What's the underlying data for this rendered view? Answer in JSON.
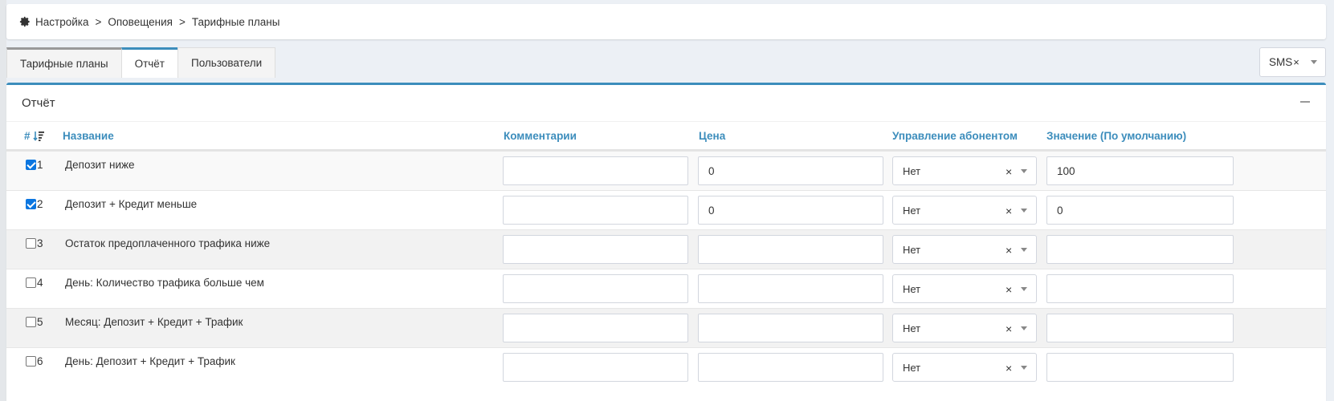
{
  "breadcrumb": {
    "icon": "gear-icon",
    "items": [
      "Настройка",
      "Оповещения",
      "Тарифные планы"
    ],
    "separator": ">"
  },
  "tabs": [
    {
      "label": "Тарифные планы",
      "active": false
    },
    {
      "label": "Отчёт",
      "active": true
    },
    {
      "label": "Пользователи",
      "active": false
    }
  ],
  "channel_select": {
    "value": "SMS",
    "clear": "×"
  },
  "box": {
    "title": "Отчёт"
  },
  "table": {
    "headers": {
      "num": "#",
      "name": "Название",
      "comment": "Комментарии",
      "price": "Цена",
      "control": "Управление абонентом",
      "value": "Значение (По умолчанию)"
    },
    "rows": [
      {
        "checked": true,
        "num": "1",
        "name": "Депозит ниже",
        "comment": "",
        "price": "0",
        "control": "Нет",
        "value": "100"
      },
      {
        "checked": true,
        "num": "2",
        "name": "Депозит + Кредит меньше",
        "comment": "",
        "price": "0",
        "control": "Нет",
        "value": "0"
      },
      {
        "checked": false,
        "num": "3",
        "name": "Остаток предоплаченного трафика ниже",
        "comment": "",
        "price": "",
        "control": "Нет",
        "value": ""
      },
      {
        "checked": false,
        "num": "4",
        "name": "День: Количество трафика больше чем",
        "comment": "",
        "price": "",
        "control": "Нет",
        "value": ""
      },
      {
        "checked": false,
        "num": "5",
        "name": "Месяц: Депозит + Кредит + Трафик",
        "comment": "",
        "price": "",
        "control": "Нет",
        "value": ""
      },
      {
        "checked": false,
        "num": "6",
        "name": "День: Депозит + Кредит + Трафик",
        "comment": "",
        "price": "",
        "control": "Нет",
        "value": ""
      }
    ],
    "clear_symbol": "×"
  },
  "colors": {
    "accent": "#3c8dbc",
    "checkbox": "#0b76e0",
    "background": "#ecf0f5"
  }
}
